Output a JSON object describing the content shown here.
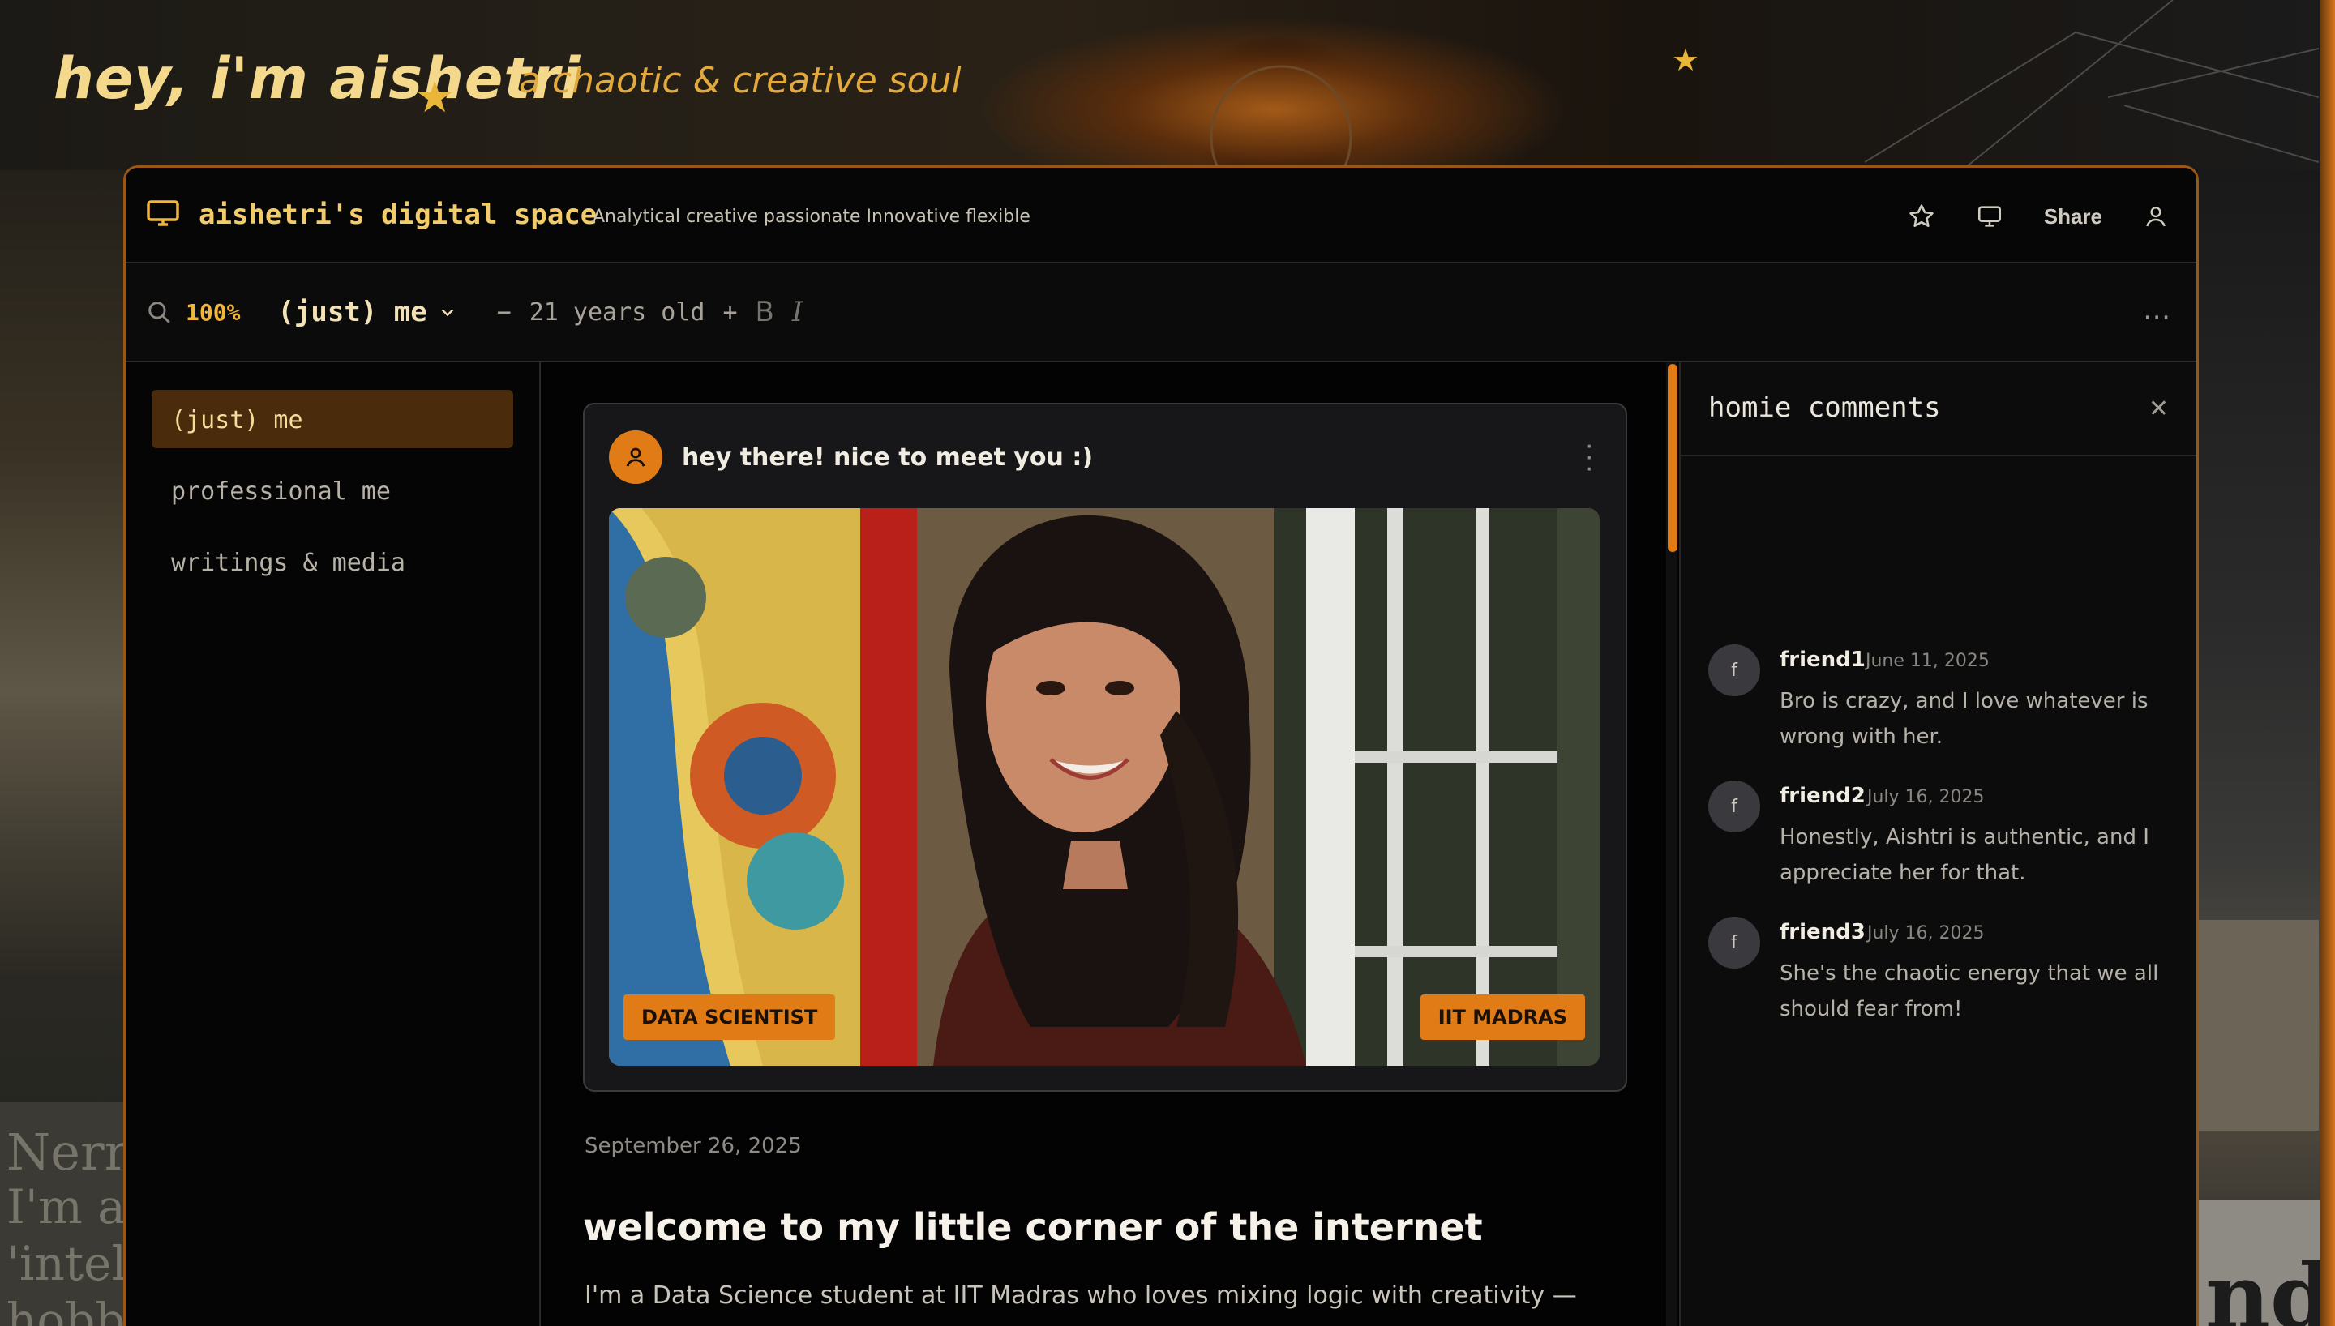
{
  "hero": {
    "title": "hey, i'm aishetri",
    "subtitle": "a chaotic & creative soul"
  },
  "background": {
    "left_text_1": "Nerr",
    "left_text_2": "I'm a g",
    "left_text_3": "'intelli",
    "left_text_4": "hobbi",
    "right_text": "nd"
  },
  "titlebar": {
    "app_icon": "monitor-icon",
    "name": "aishetri's digital space",
    "tagline": "Analytical creative passionate Innovative flexible",
    "share_label": "Share",
    "icons": [
      "star-icon",
      "monitor-icon",
      "user-icon"
    ]
  },
  "toolbar": {
    "search_icon": "search-icon",
    "zoom": "100%",
    "profile": "(just) me",
    "minus": "−",
    "age": "21 years old",
    "plus": "+",
    "bold": "B",
    "italic": "I",
    "more": "⋯"
  },
  "sidebar": {
    "items": [
      {
        "label": "(just) me",
        "active": true
      },
      {
        "label": "professional me",
        "active": false
      },
      {
        "label": "writings & media",
        "active": false
      }
    ]
  },
  "post": {
    "card_title": "hey there! nice to meet you :)",
    "tag_left": "DATA SCIENTIST",
    "tag_right": "IIT MADRAS",
    "date": "September 26, 2025",
    "title": "welcome to my little corner of the internet",
    "body": "I'm a Data Science student at IIT Madras who loves mixing logic with creativity —"
  },
  "comments": {
    "title": "homie comments",
    "items": [
      {
        "avatar": "f",
        "name": "friend1",
        "date": "June 11, 2025",
        "text": "Bro is crazy, and I love whatever is wrong with her."
      },
      {
        "avatar": "f",
        "name": "friend2",
        "date": "July 16, 2025",
        "text": "Honestly, Aishtri is authentic, and I appreciate her for that."
      },
      {
        "avatar": "f",
        "name": "friend3",
        "date": "July 16, 2025",
        "text": "She's the chaotic energy that we all should fear from!"
      }
    ]
  },
  "colors": {
    "accent": "#e07b16",
    "hero_title": "#f4d88c",
    "hero_subtitle": "#e2a93d",
    "active_nav_bg": "#4a2c0c"
  }
}
